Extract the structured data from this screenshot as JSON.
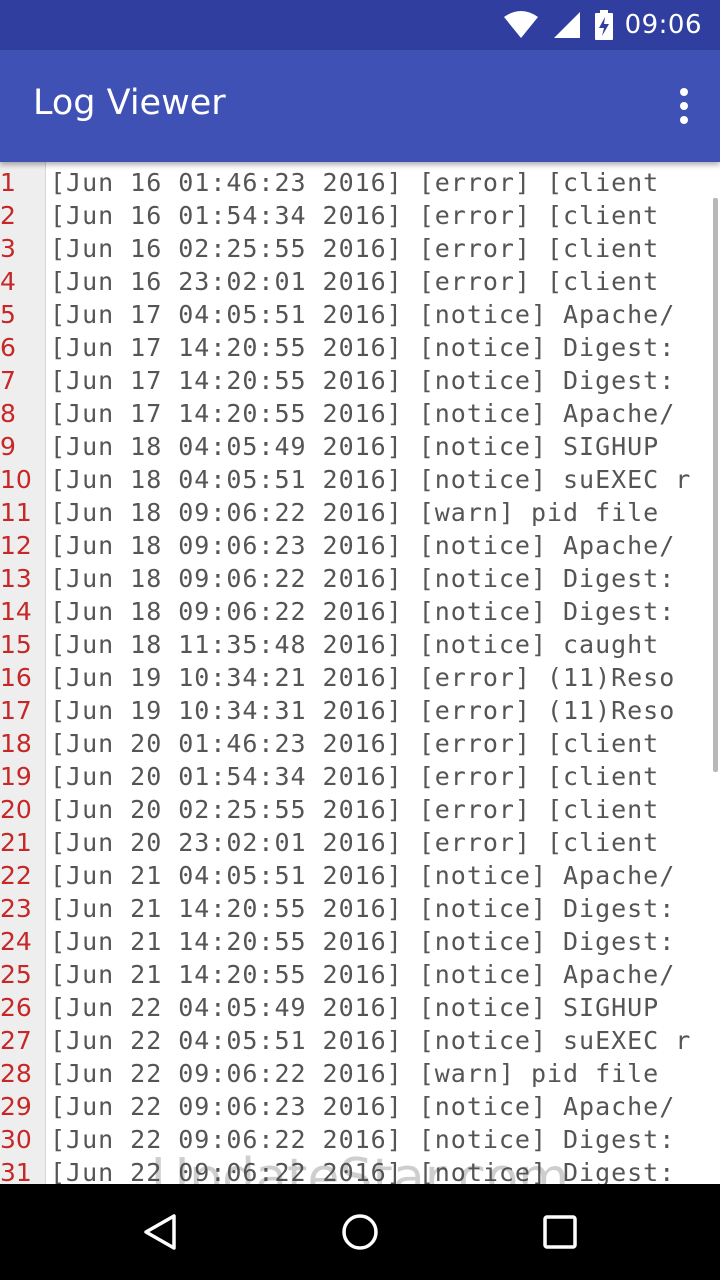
{
  "status_bar": {
    "time": "09:06",
    "icons": [
      "wifi-icon",
      "cell-signal-icon",
      "battery-charging-icon"
    ]
  },
  "app_bar": {
    "title": "Log Viewer",
    "menu_icon": "overflow-menu-icon"
  },
  "log": {
    "lines": [
      {
        "no": "1",
        "text": "[Jun 16 01:46:23 2016] [error] [client"
      },
      {
        "no": "2",
        "text": "[Jun 16 01:54:34 2016] [error] [client"
      },
      {
        "no": "3",
        "text": "[Jun 16 02:25:55 2016] [error] [client"
      },
      {
        "no": "4",
        "text": "[Jun 16 23:02:01 2016] [error] [client"
      },
      {
        "no": "5",
        "text": "[Jun 17 04:05:51 2016] [notice] Apache/"
      },
      {
        "no": "6",
        "text": "[Jun 17 14:20:55 2016] [notice] Digest:"
      },
      {
        "no": "7",
        "text": "[Jun 17 14:20:55 2016] [notice] Digest:"
      },
      {
        "no": "8",
        "text": "[Jun 17 14:20:55 2016] [notice] Apache/"
      },
      {
        "no": "9",
        "text": "[Jun 18 04:05:49 2016] [notice] SIGHUP"
      },
      {
        "no": "10",
        "text": "[Jun 18 04:05:51 2016] [notice] suEXEC r"
      },
      {
        "no": "11",
        "text": "[Jun 18 09:06:22 2016] [warn] pid file"
      },
      {
        "no": "12",
        "text": "[Jun 18 09:06:23 2016] [notice] Apache/"
      },
      {
        "no": "13",
        "text": "[Jun 18 09:06:22 2016] [notice] Digest:"
      },
      {
        "no": "14",
        "text": "[Jun 18 09:06:22 2016] [notice] Digest:"
      },
      {
        "no": "15",
        "text": "[Jun 18 11:35:48 2016] [notice] caught"
      },
      {
        "no": "16",
        "text": "[Jun 19 10:34:21 2016] [error] (11)Reso"
      },
      {
        "no": "17",
        "text": "[Jun 19 10:34:31 2016] [error] (11)Reso"
      },
      {
        "no": "18",
        "text": "[Jun 20 01:46:23 2016] [error] [client"
      },
      {
        "no": "19",
        "text": "[Jun 20 01:54:34 2016] [error] [client"
      },
      {
        "no": "20",
        "text": "[Jun 20 02:25:55 2016] [error] [client"
      },
      {
        "no": "21",
        "text": "[Jun 20 23:02:01 2016] [error] [client"
      },
      {
        "no": "22",
        "text": "[Jun 21 04:05:51 2016] [notice] Apache/"
      },
      {
        "no": "23",
        "text": "[Jun 21 14:20:55 2016] [notice] Digest:"
      },
      {
        "no": "24",
        "text": "[Jun 21 14:20:55 2016] [notice] Digest:"
      },
      {
        "no": "25",
        "text": "[Jun 21 14:20:55 2016] [notice] Apache/"
      },
      {
        "no": "26",
        "text": "[Jun 22 04:05:49 2016] [notice] SIGHUP"
      },
      {
        "no": "27",
        "text": "[Jun 22 04:05:51 2016] [notice] suEXEC r"
      },
      {
        "no": "28",
        "text": "[Jun 22 09:06:22 2016] [warn] pid file"
      },
      {
        "no": "29",
        "text": "[Jun 22 09:06:23 2016] [notice] Apache/"
      },
      {
        "no": "30",
        "text": "[Jun 22 09:06:22 2016] [notice] Digest:"
      },
      {
        "no": "31",
        "text": "[Jun 22 09:06:22 2016] [notice] Digest:"
      }
    ]
  },
  "watermark": "UpdateStar.com",
  "nav_bar": {
    "buttons": [
      "back-icon",
      "home-icon",
      "recents-icon"
    ]
  },
  "colors": {
    "status_bar": "#303f9f",
    "app_bar": "#3f51b5",
    "line_number": "#c62828",
    "log_text": "#555555",
    "gutter": "#eeeeee"
  }
}
